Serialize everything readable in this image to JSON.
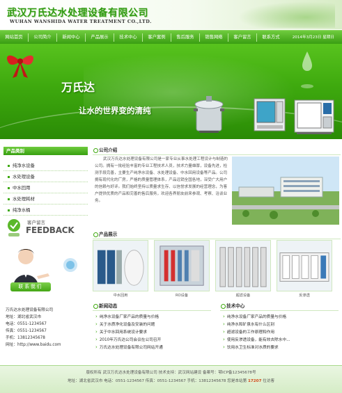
{
  "header": {
    "logo_cn": "武汉万氏达水处理设备有限公司",
    "logo_en": "WUHAN WANSHIDA WATER TREATMENT CO.,LTD."
  },
  "nav": {
    "items": [
      "网站首页",
      "公司简介",
      "新闻中心",
      "产品展示",
      "技术中心",
      "客户案例",
      "售后服务",
      "销售网络",
      "客户留言",
      "联系方式"
    ],
    "date": "2014年3月23日 星期日"
  },
  "banner": {
    "slogan1": "万氏达",
    "slogan2": "让水的世界变的清纯"
  },
  "sidebar": {
    "title": "产品类别",
    "items": [
      "纯净水设备",
      "水处理设备",
      "中水回用",
      "水处理耗材",
      "纯净水桶"
    ],
    "feedback_cn": "客户留言",
    "feedback_en": "FEEDBACK",
    "contact_button": "联系我们",
    "contact_lines": [
      "万氏达水处理设备有限公司",
      "地址：湖北省武汉市",
      "电话：0551-1234567",
      "传真：0551-1234567",
      "手机：13812345678",
      "网址：http://www.baidu.com"
    ]
  },
  "intro": {
    "title": "公司介绍",
    "text": "武汉万氏达水处理设备有限公司是一家专业从事水处理工程设计与制造的公司。拥有一批经验丰富的专业工程技术人员，技术力量雄厚，设备先进，检测手段完善，主要生产纯净水设备、水处理设备、中水回用设备等产品。公司拥有现代化的厂房，严格的质量管理体系，产品远销全国各地，深受广大用户的信赖与好评。我们始终坚持以质量求生存、以信誉求发展的经营理念，为客户提供优质的产品和完善的售后服务，欢迎各界朋友前来参观、考察、洽谈业务。"
  },
  "products": {
    "title": "产品展示",
    "captions": [
      "中水回用",
      "RO设备",
      "超滤设备",
      "反渗透"
    ]
  },
  "news": {
    "title": "新闻动态",
    "items": [
      "纯净水设备厂家产品的质量与价格",
      "关于水质净化设备及安装的问题",
      "关于中水回用系统设计要求",
      "2010年万氏达公司会议在公司召开",
      "万氏达水处理设备有限公司网站开通"
    ]
  },
  "tech": {
    "title": "技术中心",
    "items": [
      "纯净水设备厂家产品的质量与价格",
      "纯净水和矿泉水有什么区别",
      "超滤设备的工作原理和作用",
      "使用反渗透设备，能有效去除水中...",
      "饮用水卫生标准对水质的要求"
    ]
  },
  "footer": {
    "line1": "版权所有 武汉万氏达水处理设备有限公司  技术支持：武汉网站建设  备案号：鄂ICP备12345678号",
    "line2_prefix": "地址：湖北省武汉市  电话：0551-1234567  传真：0551-1234567  手机：13812345678  您是本站第",
    "line2_count": "17207",
    "line2_suffix": "位访客"
  }
}
